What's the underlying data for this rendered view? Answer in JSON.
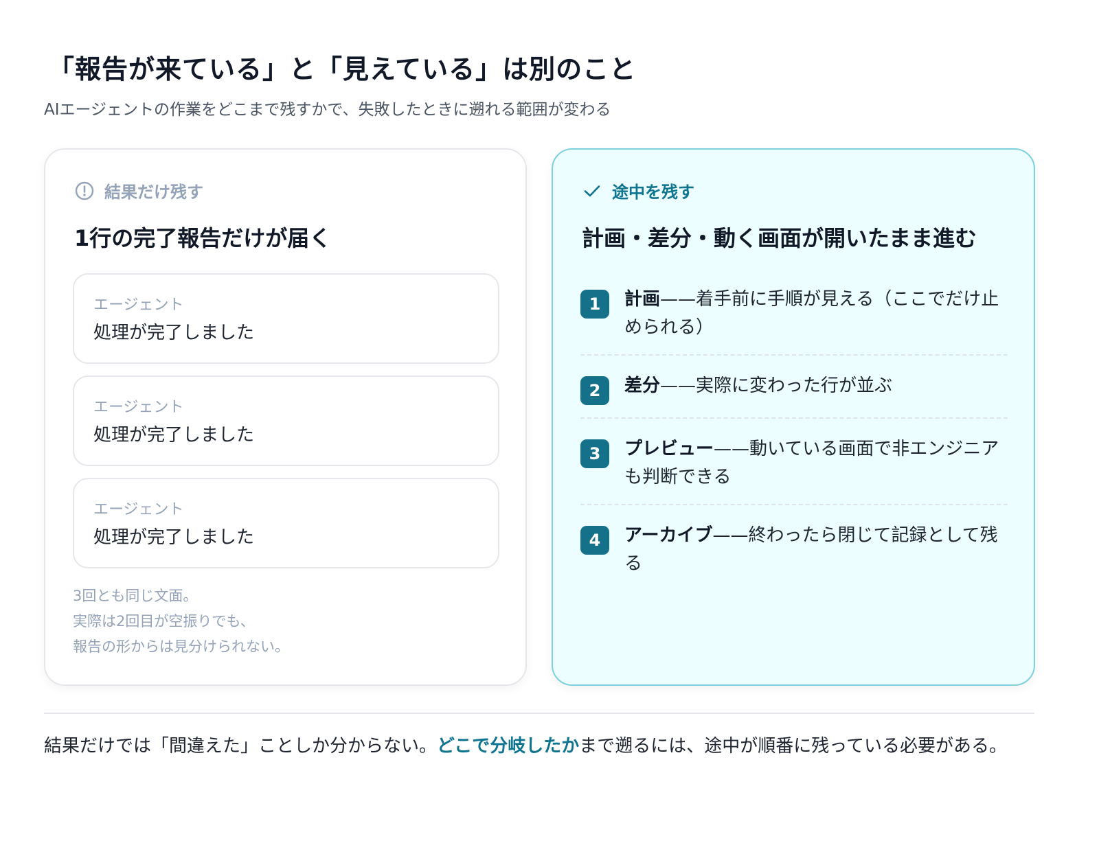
{
  "header": {
    "title": "「報告が来ている」と「見えている」は別のこと",
    "subtitle": "AIエージェントの作業をどこまで残すかで、失敗したときに遡れる範囲が変わる"
  },
  "left_card": {
    "label": "結果だけ残す",
    "icon": "alert-circle-icon",
    "heading": "1行の完了報告だけが届く",
    "messages": [
      {
        "sender": "エージェント",
        "text": "処理が完了しました"
      },
      {
        "sender": "エージェント",
        "text": "処理が完了しました"
      },
      {
        "sender": "エージェント",
        "text": "処理が完了しました"
      }
    ],
    "note": [
      "3回とも同じ文面。",
      "実際は2回目が空振りでも、",
      "報告の形からは見分けられない。"
    ]
  },
  "right_card": {
    "label": "途中を残す",
    "icon": "check-icon",
    "heading": "計画・差分・動く画面が開いたまま進む",
    "steps": [
      {
        "num": "1",
        "term": "計画",
        "desc": "——着手前に手順が見える（ここでだけ止められる）"
      },
      {
        "num": "2",
        "term": "差分",
        "desc": "——実際に変わった行が並ぶ"
      },
      {
        "num": "3",
        "term": "プレビュー",
        "desc": "——動いている画面で非エンジニアも判断できる"
      },
      {
        "num": "4",
        "term": "アーカイブ",
        "desc": "——終わったら閉じて記録として残る"
      }
    ]
  },
  "footer": {
    "before": "結果だけでは「間違えた」ことしか分からない。",
    "highlight": "どこで分岐したか",
    "after": "まで遡るには、途中が順番に残っている必要がある。"
  },
  "colors": {
    "accent": "#0f7490",
    "badge": "#15718a",
    "right_bg": "#ecfeff",
    "right_border": "#7dd0dc",
    "muted": "#94a3b8"
  }
}
